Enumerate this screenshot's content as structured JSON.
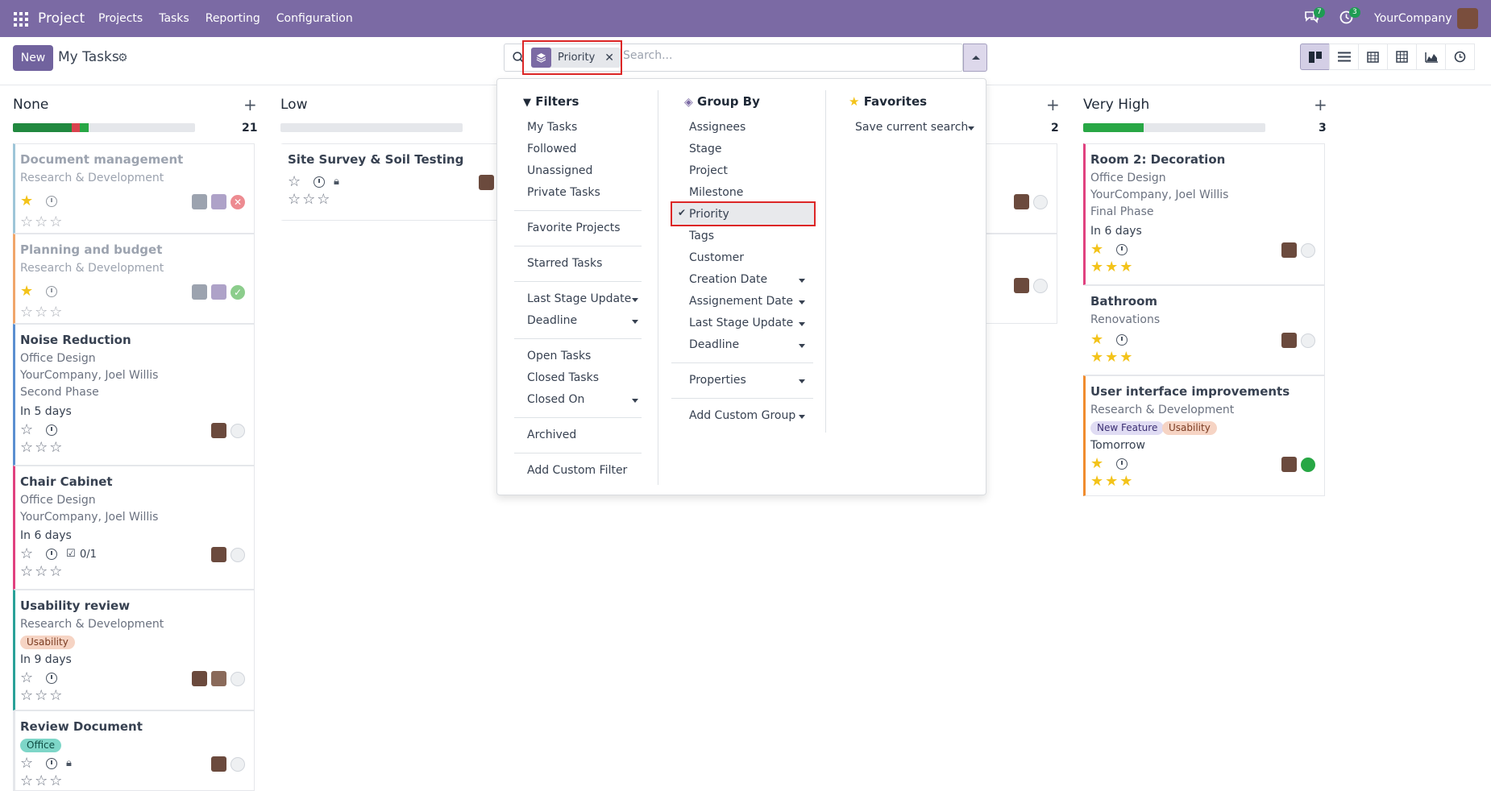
{
  "topbar": {
    "app": "Project",
    "menu": [
      "Projects",
      "Tasks",
      "Reporting",
      "Configuration"
    ],
    "messages_count": "7",
    "activities_count": "3",
    "company": "YourCompany"
  },
  "control": {
    "new_label": "New",
    "title": "My Tasks",
    "facet": "Priority",
    "search_placeholder": "Search..."
  },
  "columns": [
    {
      "name": "None",
      "count": "21"
    },
    {
      "name": "Low",
      "count": ""
    },
    {
      "name": "",
      "count": "2"
    },
    {
      "name": "Very High",
      "count": "3"
    }
  ],
  "cards_none": [
    {
      "title": "Document management",
      "project": "Research & Development"
    },
    {
      "title": "Planning and budget",
      "project": "Research & Development"
    },
    {
      "title": "Noise Reduction",
      "project": "Office Design",
      "customer": "YourCompany, Joel Willis",
      "milestone": "Second Phase",
      "deadline": "In 5 days"
    },
    {
      "title": "Chair Cabinet",
      "project": "Office Design",
      "customer": "YourCompany, Joel Willis",
      "deadline": "In 6 days",
      "subtasks": "0/1"
    },
    {
      "title": "Usability review",
      "project": "Research & Development",
      "tag": "Usability",
      "deadline": "In 9 days"
    },
    {
      "title": "Review Document",
      "tag": "Office"
    }
  ],
  "cards_low": [
    {
      "title": "Site Survey & Soil Testing"
    }
  ],
  "cards_veryhigh": [
    {
      "title": "Room 2: Decoration",
      "project": "Office Design",
      "customer": "YourCompany, Joel Willis",
      "milestone": "Final Phase",
      "deadline": "In 6 days"
    },
    {
      "title": "Bathroom",
      "project": "Renovations"
    },
    {
      "title": "User interface improvements",
      "project": "Research & Development",
      "tags": [
        "New Feature",
        "Usability"
      ],
      "deadline": "Tomorrow"
    }
  ],
  "dropdown": {
    "filters_title": "Filters",
    "filters": [
      "My Tasks",
      "Followed",
      "Unassigned",
      "Private Tasks",
      "Favorite Projects",
      "Starred Tasks",
      "Last Stage Update",
      "Deadline",
      "Open Tasks",
      "Closed Tasks",
      "Closed On",
      "Archived",
      "Add Custom Filter"
    ],
    "groupby_title": "Group By",
    "groupby": [
      "Assignees",
      "Stage",
      "Project",
      "Milestone",
      "Priority",
      "Tags",
      "Customer",
      "Creation Date",
      "Assignement Date",
      "Last Stage Update",
      "Deadline",
      "Properties",
      "Add Custom Group"
    ],
    "favorites_title": "Favorites",
    "save_search": "Save current search"
  },
  "colors": {
    "brand": "#7b6aa4",
    "star": "#f3c31a",
    "highlight": "#dc2626"
  }
}
